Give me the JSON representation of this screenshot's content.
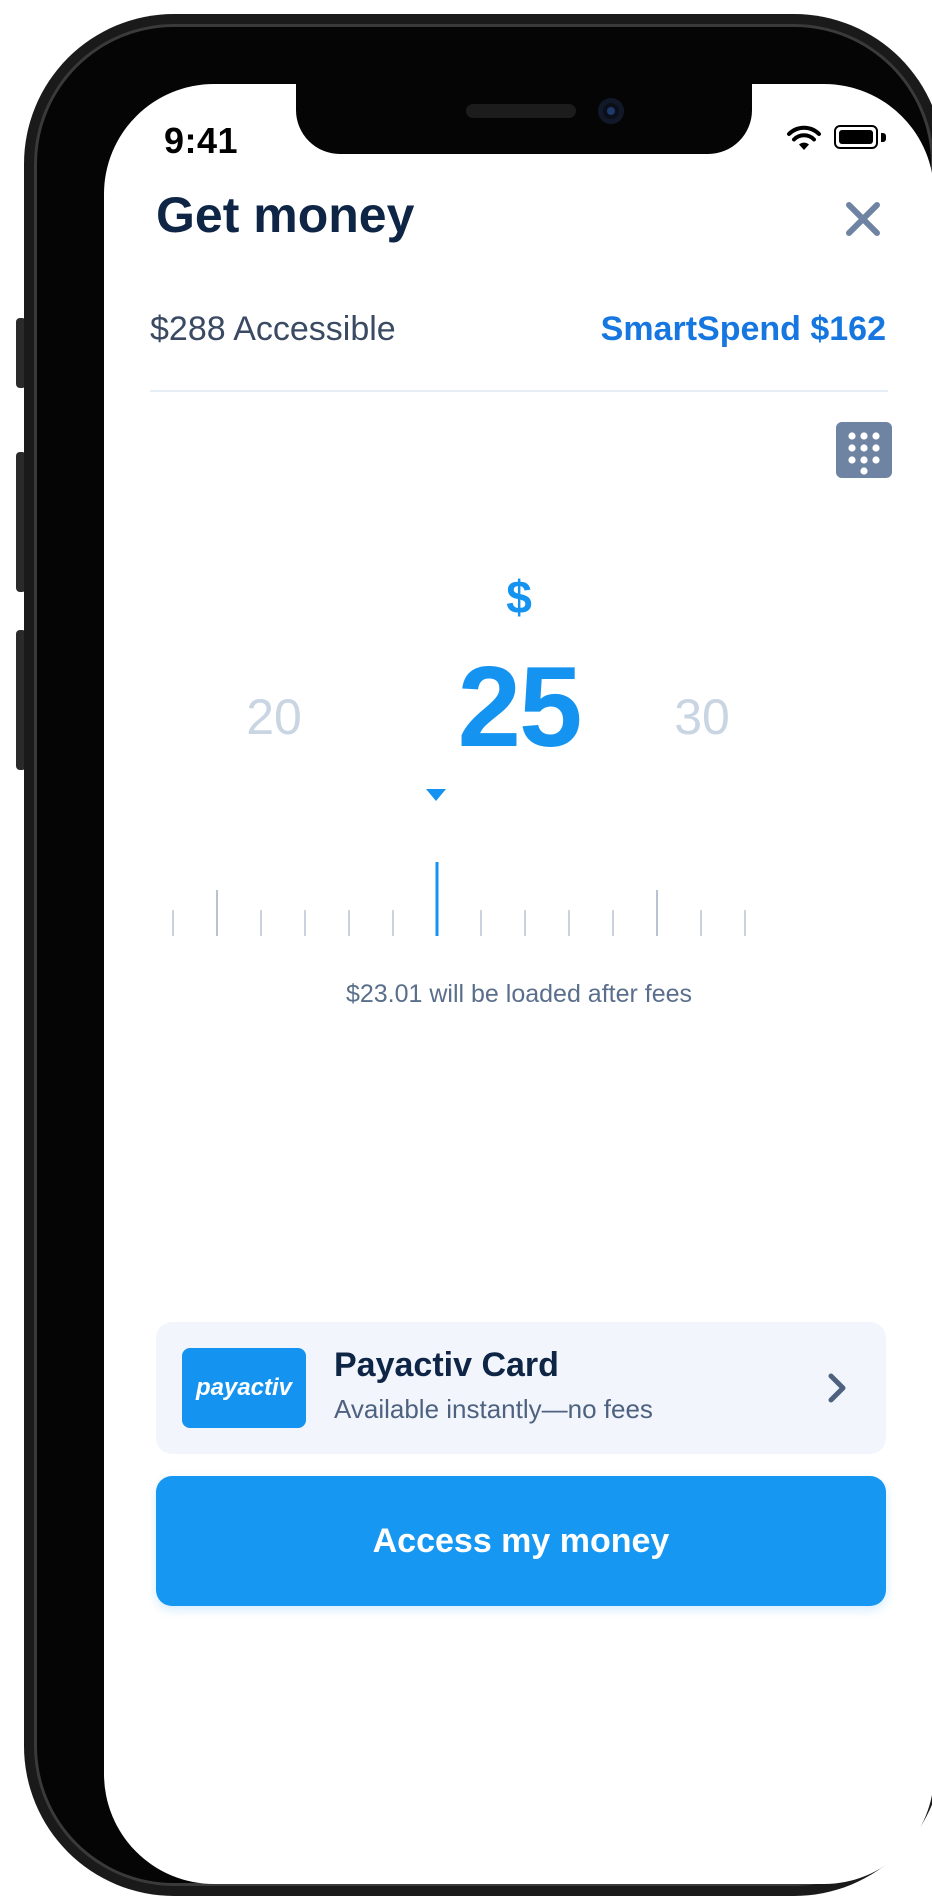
{
  "status_bar": {
    "time": "9:41"
  },
  "header": {
    "title": "Get money"
  },
  "balances": {
    "accessible": "$288 Accessible",
    "smartspend": "SmartSpend $162"
  },
  "amount_picker": {
    "currency": "$",
    "selected": "25",
    "previous": "20",
    "next": "30",
    "fees_note": "$23.01 will be loaded after fees"
  },
  "payment_method": {
    "logo_text": "payactiv",
    "title": "Payactiv Card",
    "subtitle": "Available instantly—no fees"
  },
  "cta": {
    "label": "Access my money"
  },
  "colors": {
    "brand_blue": "#1593f0",
    "link_blue": "#1677e0",
    "title_navy": "#0e2545",
    "muted_number": "#c9d5e3"
  },
  "icons": [
    "wifi-icon",
    "battery-icon",
    "close-icon",
    "keypad-icon",
    "caret-down-icon",
    "chevron-right-icon"
  ]
}
